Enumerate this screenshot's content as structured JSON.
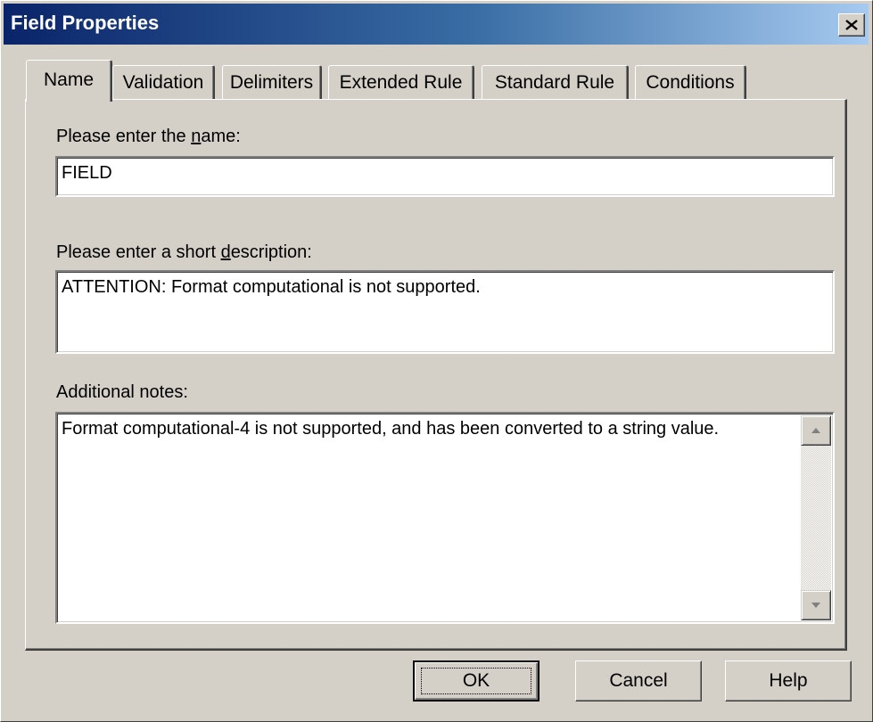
{
  "window": {
    "title": "Field Properties"
  },
  "tabs": [
    {
      "label": "Name",
      "active": true
    },
    {
      "label": "Validation",
      "active": false
    },
    {
      "label": "Delimiters",
      "active": false
    },
    {
      "label": "Extended Rule",
      "active": false
    },
    {
      "label": "Standard Rule",
      "active": false
    },
    {
      "label": "Conditions",
      "active": false
    }
  ],
  "name_section": {
    "label_prefix": "Please enter the ",
    "label_access": "n",
    "label_suffix": "ame:",
    "value": "FIELD"
  },
  "description_section": {
    "label_prefix": "Please enter a short ",
    "label_access": "d",
    "label_suffix": "escription:",
    "value": "ATTENTION: Format computational is not supported."
  },
  "notes_section": {
    "label": "Additional notes:",
    "value": "Format computational-4 is not supported, and has been converted to a string value."
  },
  "buttons": {
    "ok": "OK",
    "cancel": "Cancel",
    "help": "Help"
  },
  "icons": {
    "close": "close-icon",
    "scroll_up": "scroll-up-arrow-icon",
    "scroll_down": "scroll-down-arrow-icon"
  },
  "colors": {
    "titlebar_start": "#0a246a",
    "titlebar_end": "#a6caf0",
    "face": "#d4d0c8"
  }
}
